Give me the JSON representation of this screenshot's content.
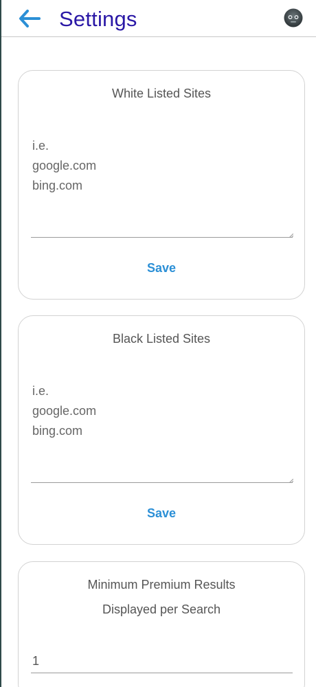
{
  "header": {
    "title": "Settings",
    "back_icon": "arrow-left-icon",
    "avatar_icon": "robot-avatar-icon",
    "accent_color": "#2b8fd6",
    "title_color": "#2a18a6"
  },
  "white_list": {
    "title": "White Listed Sites",
    "placeholder": "i.e.\ngoogle.com\nbing.com",
    "value": "",
    "save_label": "Save"
  },
  "black_list": {
    "title": "Black Listed Sites",
    "placeholder": "i.e.\ngoogle.com\nbing.com",
    "value": "",
    "save_label": "Save"
  },
  "premium": {
    "title_line1": "Minimum Premium Results",
    "title_line2": "Displayed per Search",
    "value": "1"
  }
}
